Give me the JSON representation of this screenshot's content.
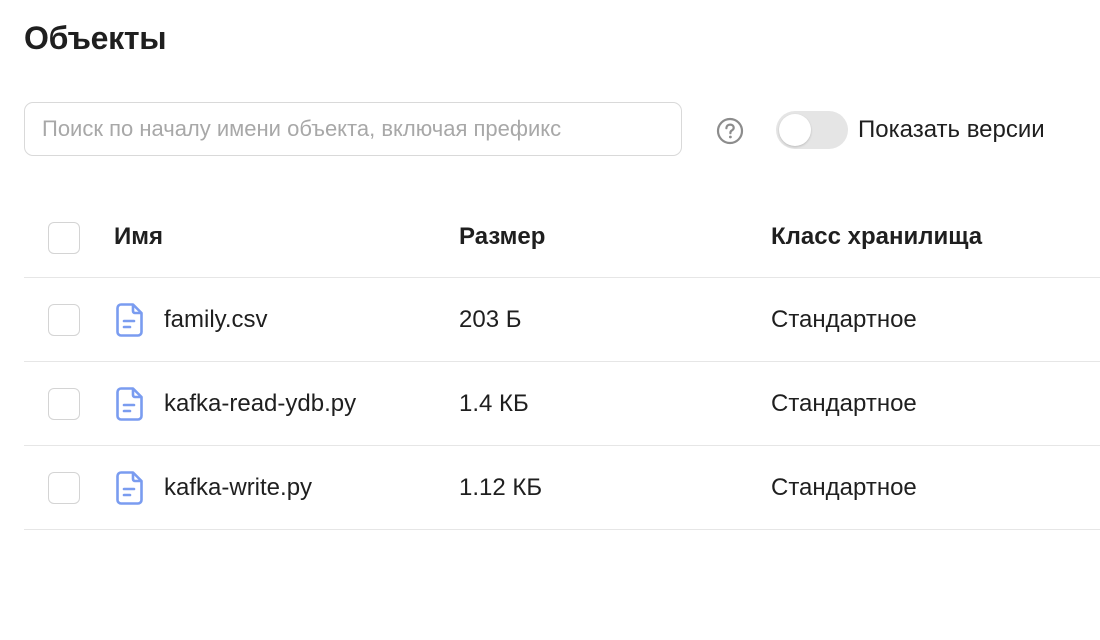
{
  "page": {
    "title": "Объекты"
  },
  "search": {
    "placeholder": "Поиск по началу имени объекта, включая префикс",
    "value": ""
  },
  "toolbar": {
    "help_icon": "question-circle-icon",
    "versions_toggle_label": "Показать версии",
    "versions_toggle_on": false
  },
  "table": {
    "columns": [
      "Имя",
      "Размер",
      "Класс хранилища"
    ],
    "rows": [
      {
        "name": "family.csv",
        "size": "203 Б",
        "storage_class": "Стандартное",
        "icon": "file-icon"
      },
      {
        "name": "kafka-read-ydb.py",
        "size": "1.4 КБ",
        "storage_class": "Стандартное",
        "icon": "file-icon"
      },
      {
        "name": "kafka-write.py",
        "size": "1.12 КБ",
        "storage_class": "Стандартное",
        "icon": "file-icon"
      }
    ]
  },
  "colors": {
    "icon_accent": "#7a9cf0",
    "text": "#1f1f1f",
    "placeholder": "#a8a8a8",
    "border": "#d9d9d9",
    "divider": "#e6e6e6",
    "toggle_off": "#e5e5e5"
  }
}
